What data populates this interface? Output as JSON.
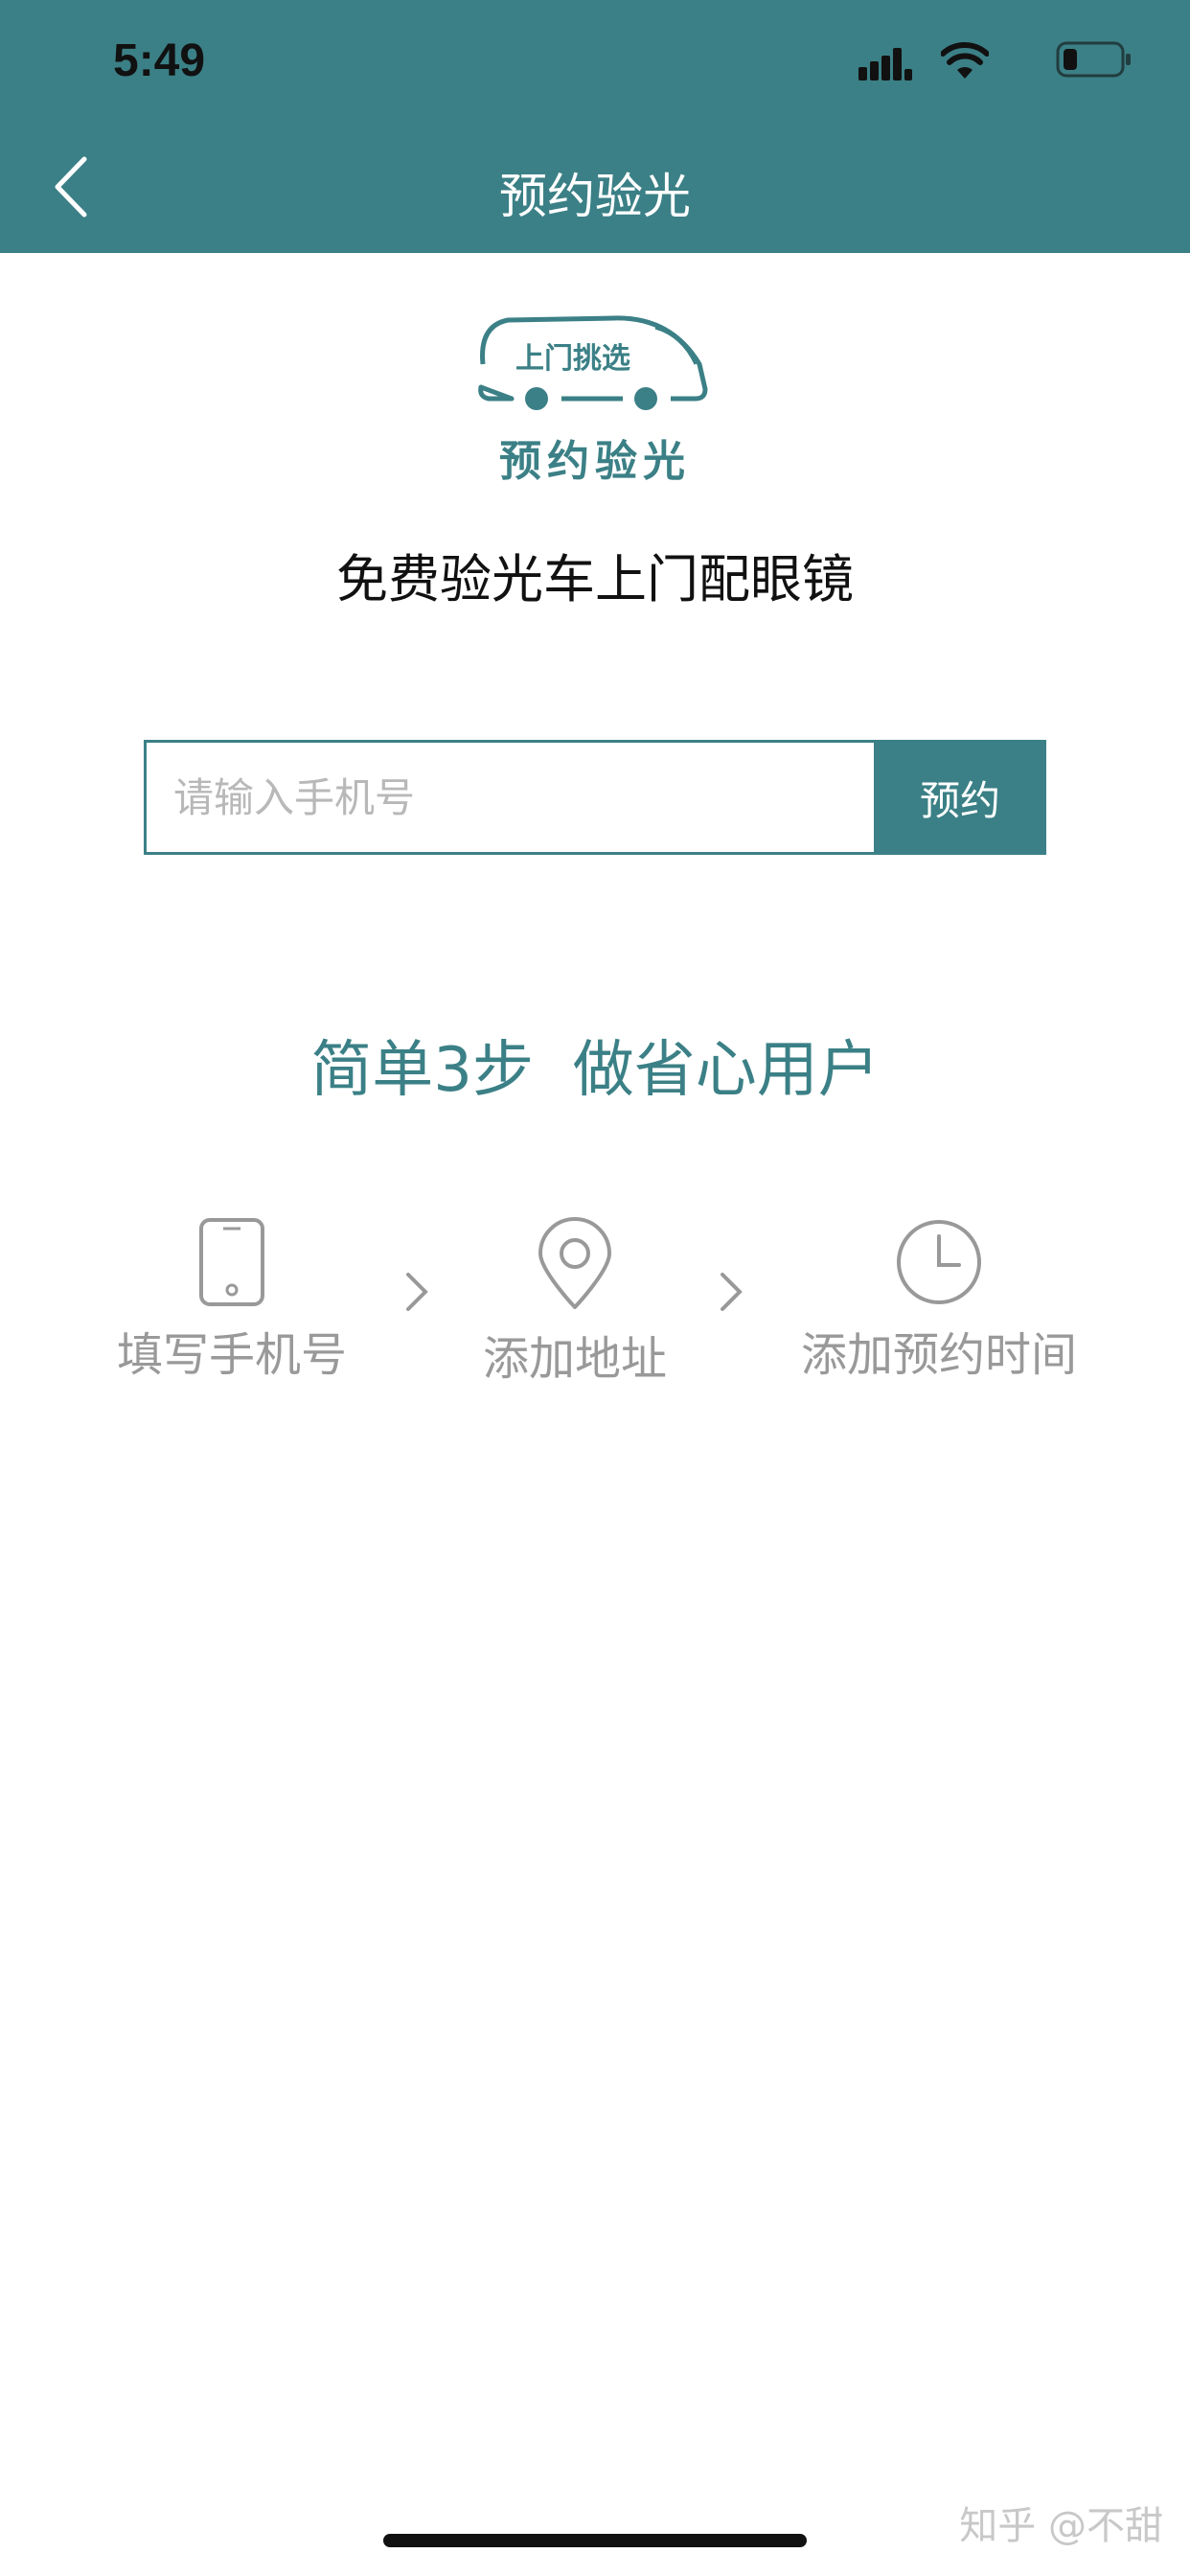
{
  "status_bar": {
    "time": "5:49",
    "icons": [
      "signal-icon",
      "wifi-icon",
      "battery-icon"
    ]
  },
  "nav": {
    "back_icon": "chevron-left-icon",
    "title": "预约验光"
  },
  "logo": {
    "badge_text": "上门挑选",
    "text": "预约验光"
  },
  "tagline": "免费验光车上门配眼镜",
  "form": {
    "phone_placeholder": "请输入手机号",
    "phone_value": "",
    "submit_label": "预约"
  },
  "steps_headline": "简单3步  做省心用户",
  "steps": [
    {
      "icon": "phone-icon",
      "label": "填写手机号"
    },
    {
      "icon": "location-pin-icon",
      "label": "添加地址"
    },
    {
      "icon": "clock-icon",
      "label": "添加预约时间"
    }
  ],
  "step_arrow_icon": "chevron-right-icon",
  "watermark": "知乎 @不甜",
  "colors": {
    "brand": "#3b8086",
    "muted": "#999999",
    "placeholder": "#b8b8b8"
  }
}
